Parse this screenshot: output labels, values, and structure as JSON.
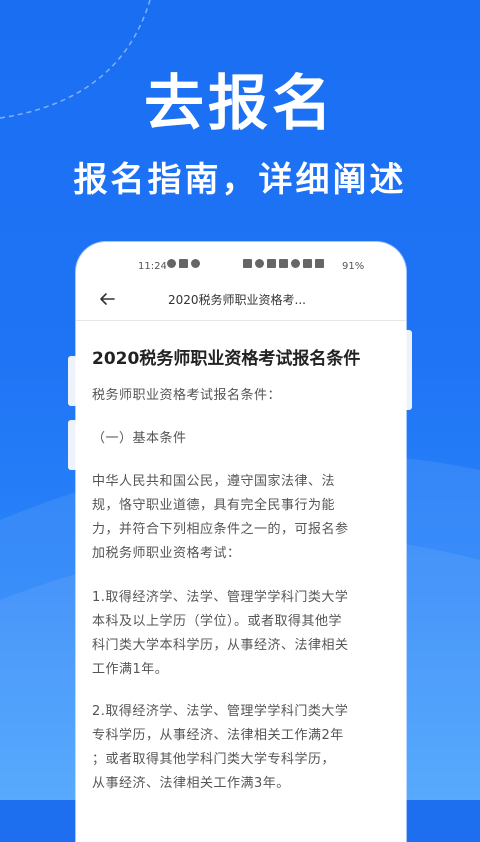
{
  "hero": {
    "title": "去报名",
    "subtitle": "报名指南，详细阐述"
  },
  "status_bar": {
    "time": "11:24",
    "battery": "91%"
  },
  "appbar": {
    "back_icon": "arrow-left-icon",
    "title": "2020税务师职业资格考..."
  },
  "article": {
    "title": "2020税务师职业资格考试报名条件",
    "paragraphs": [
      "税务师职业资格考试报名条件：",
      "（一）基本条件",
      "中华人民共和国公民，遵守国家法律、法",
      "规，恪守职业道德，具有完全民事行为能",
      "力，并符合下列相应条件之一的，可报名参",
      "加税务师职业资格考试：",
      "1.取得经济学、法学、管理学学科门类大学",
      "本科及以上学历（学位）。或者取得其他学",
      "科门类大学本科学历，从事经济、法律相关",
      "工作满1年。",
      "2.取得经济学、法学、管理学学科门类大学",
      "专科学历，从事经济、法律相关工作满2年",
      "；或者取得其他学科门类大学专科学历，",
      "从事经济、法律相关工作满3年。"
    ]
  },
  "colors": {
    "background": "#1e6ff0",
    "card": "#ffffff",
    "text": "#555555"
  }
}
